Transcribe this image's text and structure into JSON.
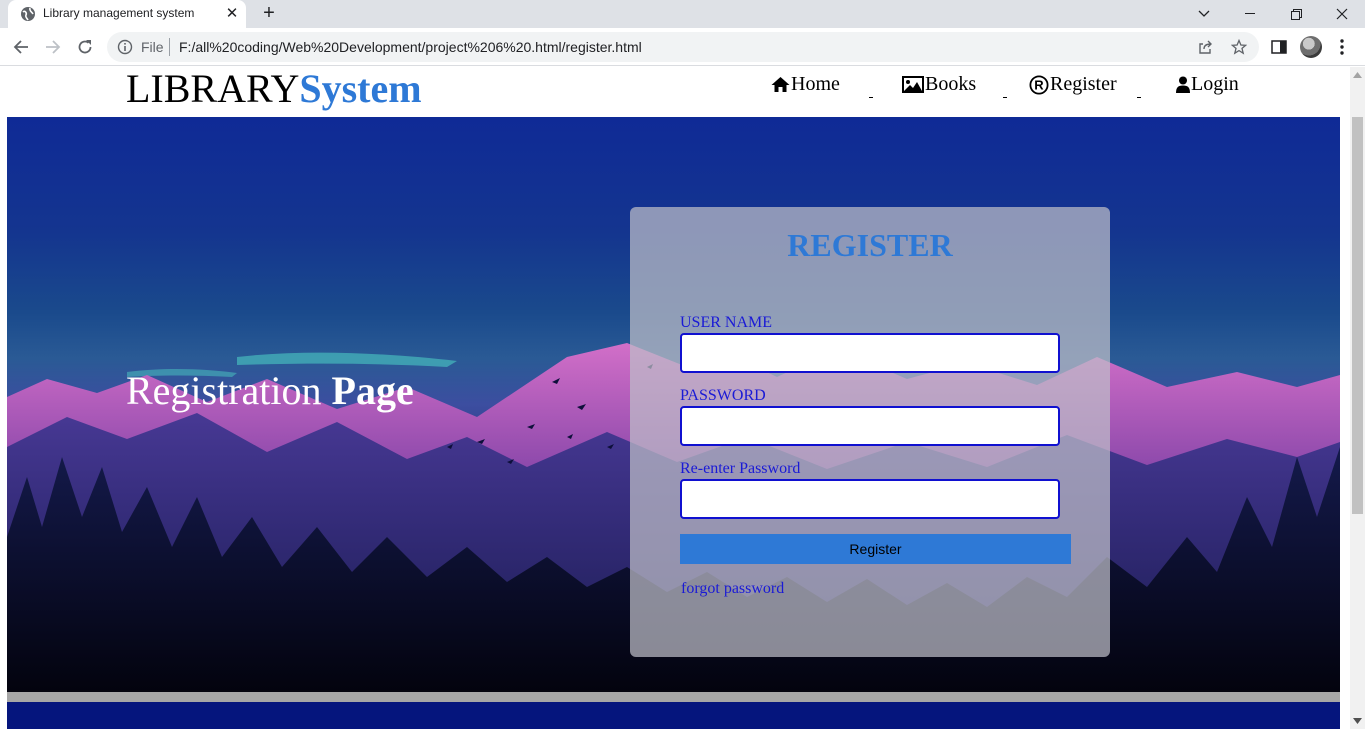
{
  "browser": {
    "tab_title": "Library management system",
    "scheme_label": "File",
    "url": "F:/all%20coding/Web%20Development/project%206%20.html/register.html"
  },
  "site": {
    "brand_part1": "LIBRARY",
    "brand_part2": "System",
    "nav": [
      {
        "label": "Home",
        "icon": "home-icon"
      },
      {
        "label": "Books",
        "icon": "image-icon"
      },
      {
        "label": "Register",
        "icon": "registered-icon"
      },
      {
        "label": "Login",
        "icon": "user-icon"
      }
    ]
  },
  "hero": {
    "title_part1": "Registration",
    "title_part2": "Page"
  },
  "form": {
    "title": "REGISTER",
    "username_label": "USER NAME",
    "username_value": "",
    "password_label": "PASSWORD",
    "password_value": "",
    "reenter_label": "Re-enter Password",
    "reenter_value": "",
    "submit_label": "Register",
    "forgot_label": "forgot password"
  },
  "colors": {
    "accent": "#2e79d6",
    "label_blue": "#1a1ad6",
    "footer": "#05157d"
  }
}
